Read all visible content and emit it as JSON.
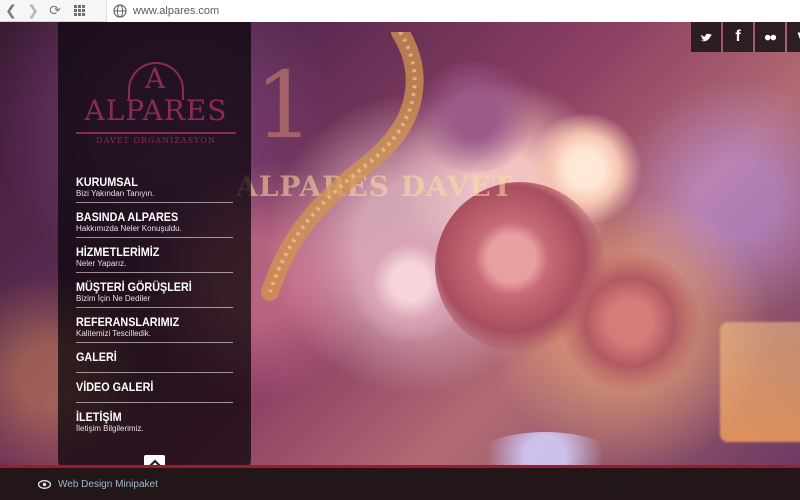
{
  "browser": {
    "url": "www.alpares.com",
    "icons": [
      "back-icon",
      "forward-icon",
      "reload-icon",
      "apps-icon",
      "globe-icon"
    ]
  },
  "logo": {
    "letter": "A",
    "name": "ALPARES",
    "tagline": "DAVET ORGANİZASYON"
  },
  "social": {
    "items": [
      "twitter-icon",
      "facebook-icon",
      "flickr-icon",
      "vimeo-icon"
    ],
    "facebook_glyph": "f",
    "vimeo_glyph": "v"
  },
  "photo": {
    "sign_text": "ALPARES DAVET",
    "table_number": "1"
  },
  "menu": {
    "items": [
      {
        "label": "KURUMSAL",
        "sub": "Bizi Yakından Tanıyın."
      },
      {
        "label": "BASINDA ALPARES",
        "sub": "Hakkımızda Neler Konuşuldu."
      },
      {
        "label": "HİZMETLERİMİZ",
        "sub": "Neler Yaparız."
      },
      {
        "label": "MÜŞTERİ GÖRÜŞLERİ",
        "sub": "Bizim İçin Ne Dediler"
      },
      {
        "label": "REFERANSLARIMIZ",
        "sub": "Kalitemizi Tescilledik."
      },
      {
        "label": "GALERİ",
        "sub": ""
      },
      {
        "label": "VİDEO GALERİ",
        "sub": ""
      },
      {
        "label": "İLETİŞİM",
        "sub": "İletişim Bilgilerimiz."
      }
    ]
  },
  "footer": {
    "credit": "Web Design Minipaket"
  },
  "colors": {
    "brand": "#8a2b56",
    "footer_line": "#9e1b2c",
    "footer_text": "#9db7cc"
  }
}
